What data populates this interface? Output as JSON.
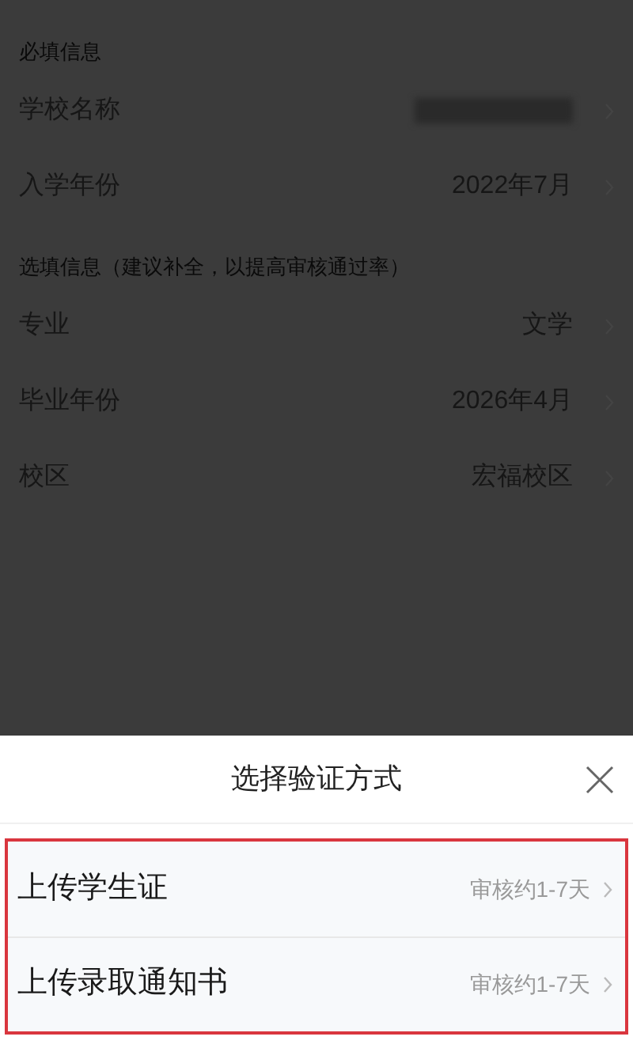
{
  "form_sections": [
    {
      "header": "必填信息",
      "rows": [
        {
          "label": "学校名称",
          "redacted": true
        },
        {
          "label": "入学年份",
          "value": "2022年7月"
        }
      ]
    },
    {
      "header": "选填信息（建议补全，以提高审核通过率）",
      "rows": [
        {
          "label": "专业",
          "value": "文学"
        },
        {
          "label": "毕业年份",
          "value": "2026年4月"
        },
        {
          "label": "校区",
          "value": "宏福校区"
        }
      ]
    }
  ],
  "sheet": {
    "title": "选择验证方式",
    "highlighted": true,
    "options": [
      {
        "label": "上传学生证",
        "note": "审核约1-7天"
      },
      {
        "label": "上传录取通知书",
        "note": "审核约1-7天"
      }
    ]
  }
}
